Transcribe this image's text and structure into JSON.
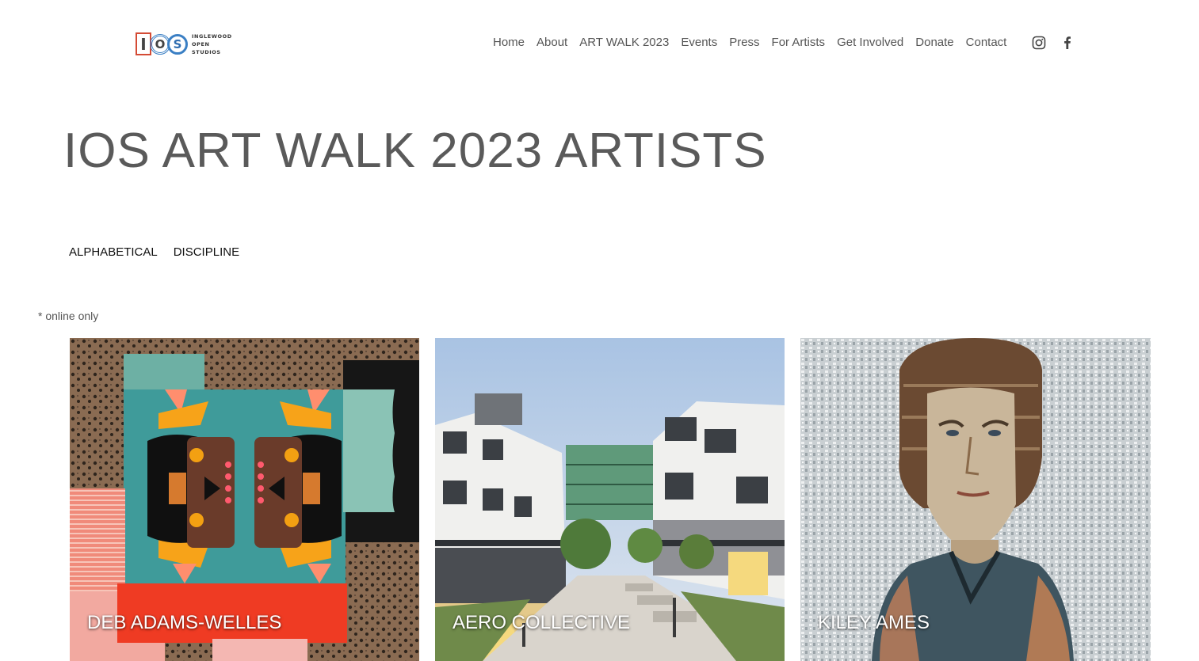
{
  "logo": {
    "letters": [
      "I",
      "O",
      "S"
    ],
    "line1": "INGLEWOOD",
    "line2": "OPEN",
    "line3": "STUDIOS"
  },
  "nav": {
    "items": [
      "Home",
      "About",
      "ART WALK 2023",
      "Events",
      "Press",
      "For Artists",
      "Get Involved",
      "Donate",
      "Contact"
    ]
  },
  "social": {
    "instagram_icon": "instagram-icon",
    "facebook_icon": "facebook-icon"
  },
  "page": {
    "title": "IOS ART WALK 2023 ARTISTS",
    "filters": [
      "ALPHABETICAL",
      "DISCIPLINE"
    ],
    "note": "* online only"
  },
  "artists": [
    {
      "name": "DEB ADAMS-WELLES"
    },
    {
      "name": "AERO COLLECTIVE"
    },
    {
      "name": "KILEY AMES"
    }
  ],
  "colors": {
    "text": "#555555",
    "title": "#5a5a5a",
    "logo_red": "#d44b35",
    "logo_blue": "#3a7fc4"
  }
}
